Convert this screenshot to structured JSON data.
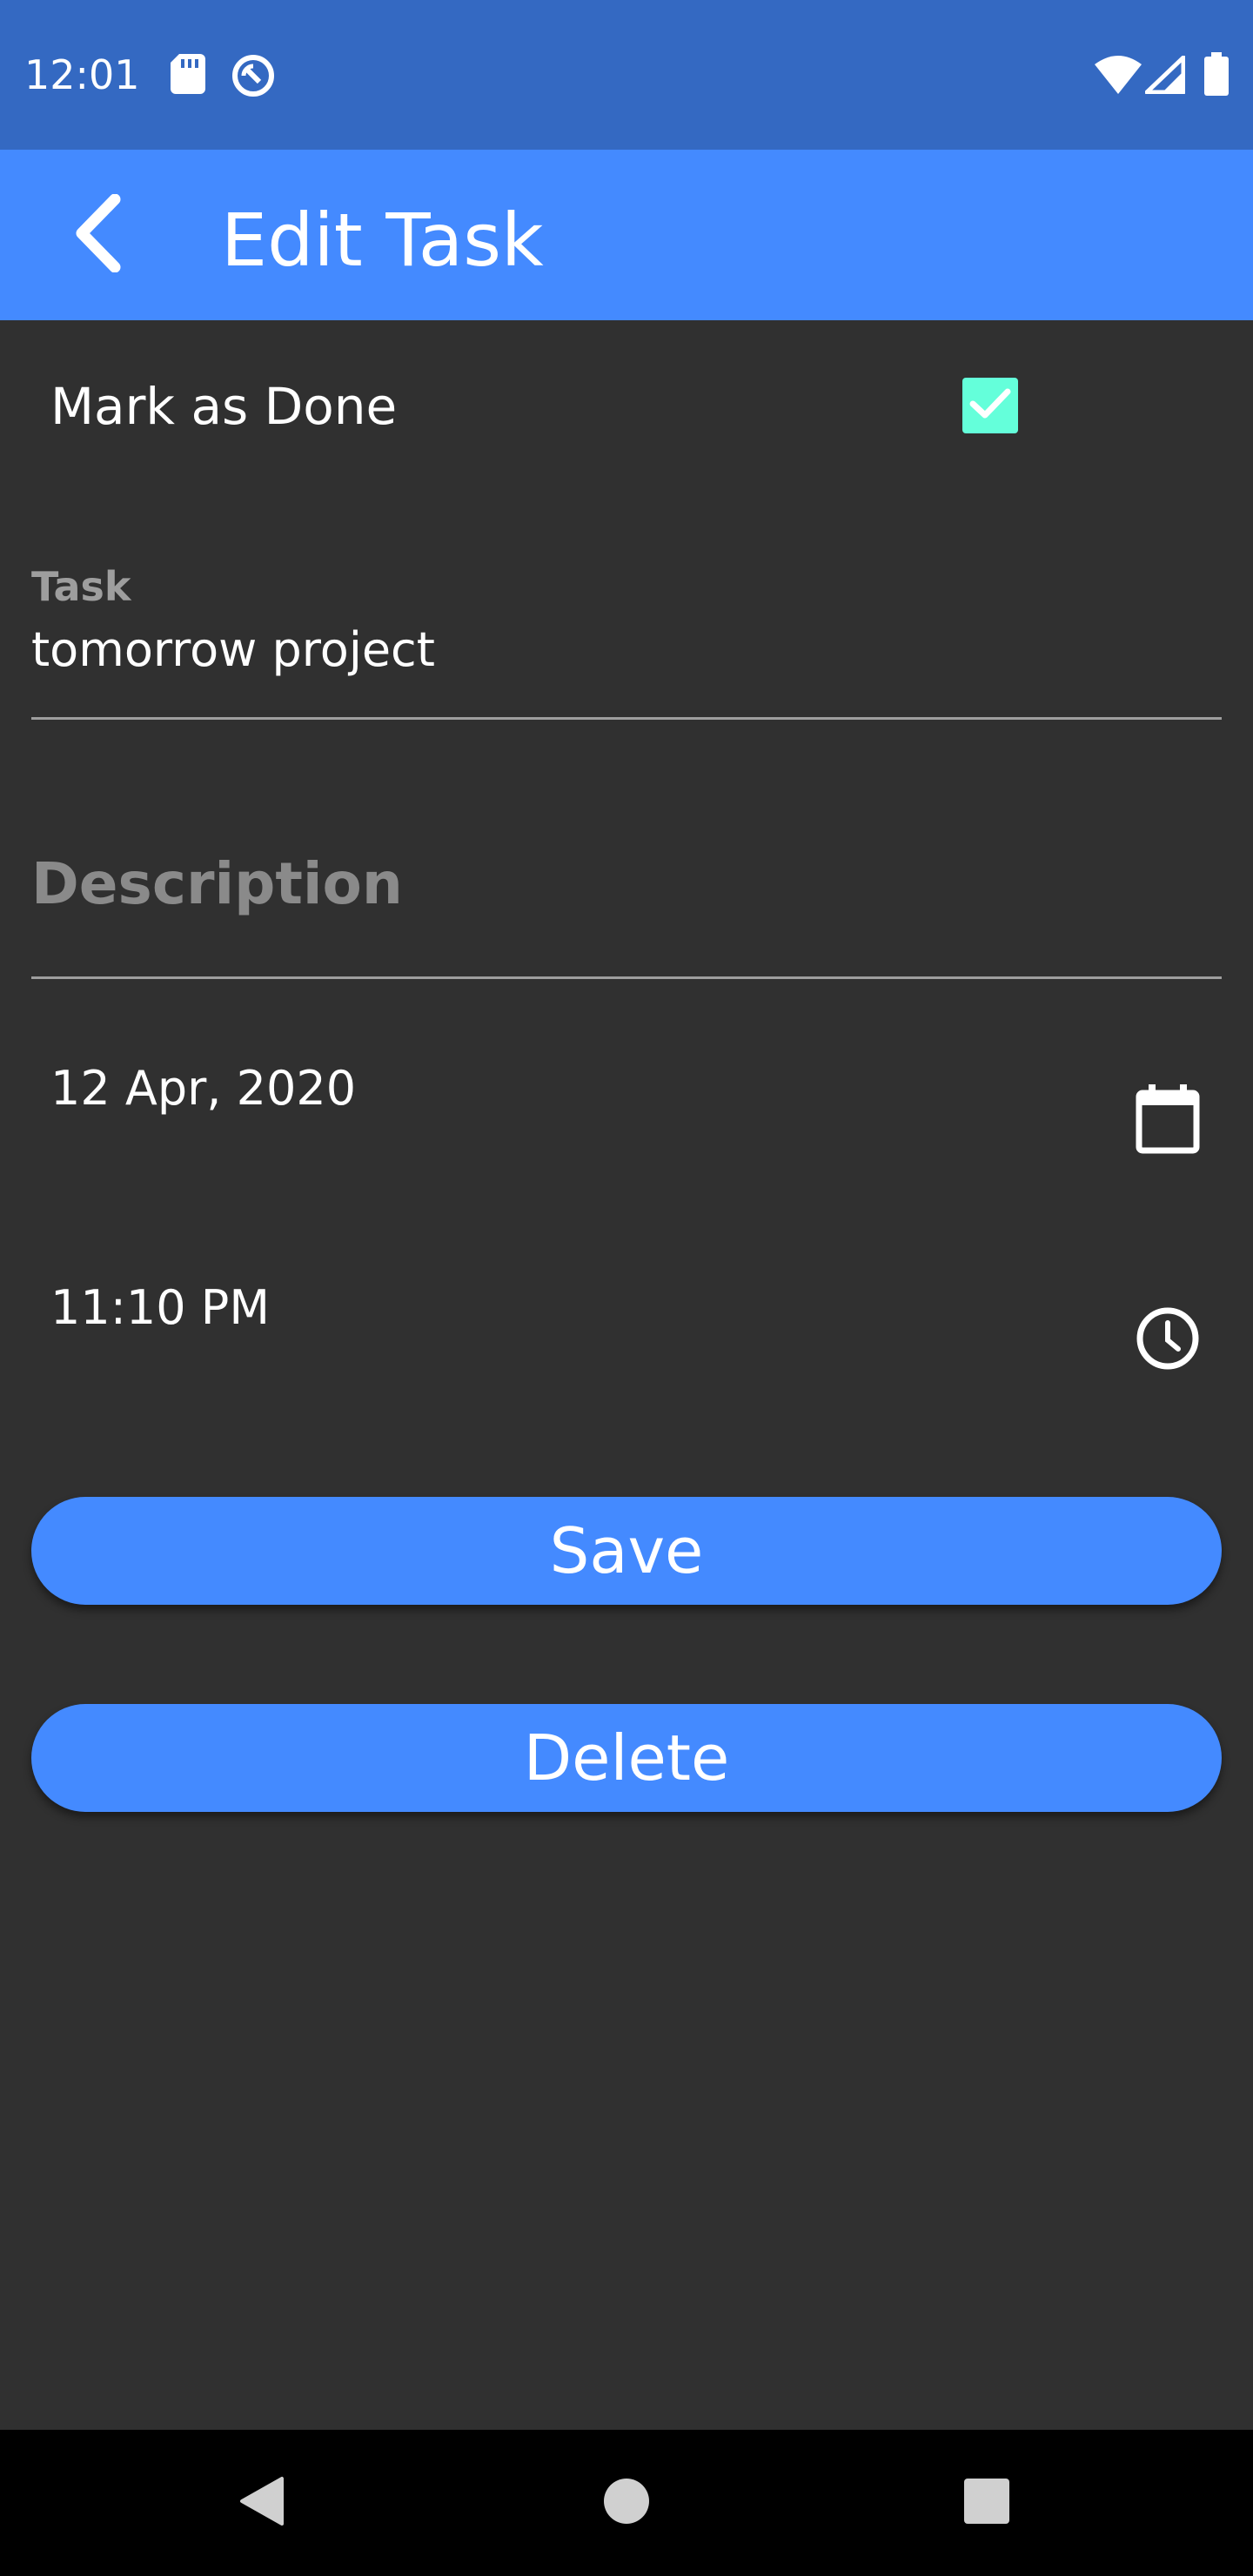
{
  "status_bar": {
    "time": "12:01",
    "icons": [
      "sd-card-icon",
      "sync-disabled-icon",
      "wifi-icon",
      "signal-icon",
      "battery-icon"
    ]
  },
  "app_bar": {
    "title": "Edit Task",
    "back_icon": "chevron-left-icon"
  },
  "form": {
    "mark_done": {
      "label": "Mark as Done",
      "checked": true
    },
    "task": {
      "label": "Task",
      "value": "tomorrow project"
    },
    "description": {
      "placeholder": "Description",
      "value": ""
    },
    "date": {
      "value": "12 Apr, 2020",
      "icon": "calendar-icon"
    },
    "time": {
      "value": "11:10 PM",
      "icon": "clock-icon"
    }
  },
  "actions": {
    "save_label": "Save",
    "delete_label": "Delete"
  },
  "nav_bar": {
    "icons": [
      "back-triangle-icon",
      "home-circle-icon",
      "recents-square-icon"
    ]
  },
  "colors": {
    "status_bar": "#3469c2",
    "app_bar": "#448aff",
    "background": "#303030",
    "checkbox": "#64ffda",
    "button": "#448aff"
  }
}
